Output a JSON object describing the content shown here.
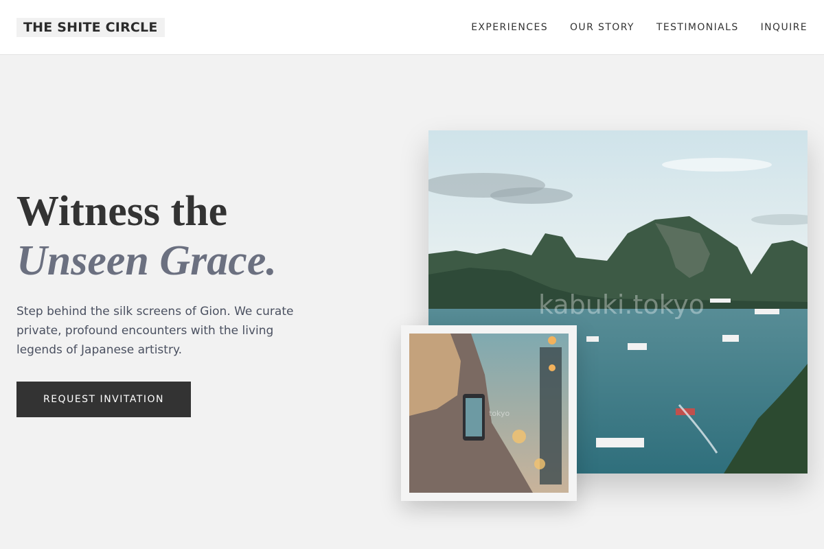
{
  "header": {
    "logo": "THE SHITE CIRCLE",
    "nav": [
      "EXPERIENCES",
      "OUR STORY",
      "TESTIMONIALS",
      "INQUIRE"
    ]
  },
  "hero": {
    "title_line1": "Witness the",
    "title_line2": "Unseen Grace.",
    "description": "Step behind the silk screens of Gion. We curate private, profound encounters with the living legends of Japanese artistry.",
    "cta_label": "REQUEST INVITATION"
  },
  "images": {
    "main_watermark": "kabuki.tokyo",
    "small_watermark": "tokyo"
  },
  "colors": {
    "background": "#f2f2f2",
    "header_bg": "#ffffff",
    "button_bg": "#333333",
    "accent_text": "#6b7080"
  }
}
